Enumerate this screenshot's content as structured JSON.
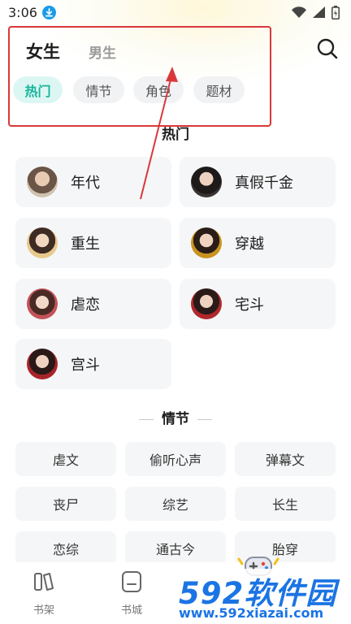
{
  "status_bar": {
    "time": "3:06"
  },
  "header": {
    "gender_tabs": [
      {
        "label": "女生",
        "active": true
      },
      {
        "label": "男生",
        "active": false
      }
    ],
    "chips": [
      {
        "label": "热门",
        "active": true
      },
      {
        "label": "情节",
        "active": false
      },
      {
        "label": "角色",
        "active": false
      },
      {
        "label": "题材",
        "active": false
      }
    ],
    "search_icon": "search-icon"
  },
  "popular": {
    "title": "热门",
    "items": [
      {
        "label": "年代"
      },
      {
        "label": "真假千金"
      },
      {
        "label": "重生"
      },
      {
        "label": "穿越"
      },
      {
        "label": "虐恋"
      },
      {
        "label": "宅斗"
      },
      {
        "label": "宫斗"
      }
    ]
  },
  "plot": {
    "title": "情节",
    "items": [
      {
        "label": "虐文"
      },
      {
        "label": "偷听心声"
      },
      {
        "label": "弹幕文"
      },
      {
        "label": "丧尸"
      },
      {
        "label": "综艺"
      },
      {
        "label": "长生"
      },
      {
        "label": "恋综"
      },
      {
        "label": "通古今"
      },
      {
        "label": "胎穿"
      }
    ]
  },
  "bottom_nav": {
    "items": [
      {
        "label": "书架",
        "icon": "bookshelf-icon"
      },
      {
        "label": "书城",
        "icon": "bookstore-icon"
      }
    ]
  },
  "watermark": {
    "brand": "592软件园",
    "url": "www.592xiazai.com"
  },
  "colors": {
    "accent_teal": "#17b39b",
    "annotation_red": "#d9383a",
    "chip_bg": "#f1f2f4",
    "card_bg": "#f5f6f7"
  }
}
